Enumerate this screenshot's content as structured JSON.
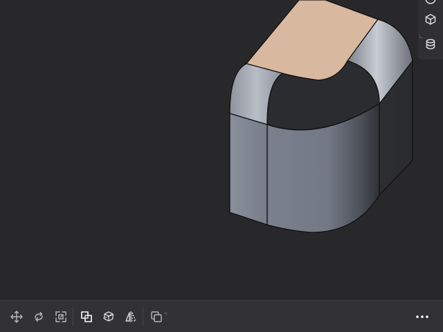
{
  "viewport": {
    "background": "#28282b",
    "model": {
      "top_face_color": "#d9b8a0",
      "side_face_color": "#7d8391",
      "edge_color": "#111111"
    }
  },
  "side_panel": {
    "buttons": [
      {
        "icon": "sphere-icon",
        "state": "partially-visible"
      },
      {
        "icon": "cube-icon"
      },
      {
        "icon": "cylinder-icon"
      }
    ]
  },
  "toolbar": {
    "groups": [
      [
        "move-icon",
        "rotate-icon",
        "scale-icon"
      ],
      [
        "boolean-icon",
        "section-icon",
        "mirror-icon"
      ],
      [
        "duplicate-icon"
      ]
    ],
    "more_icon": "more-horizontal-icon",
    "icon_color": "#b8b8be",
    "active_icon_color": "#ffffff"
  }
}
